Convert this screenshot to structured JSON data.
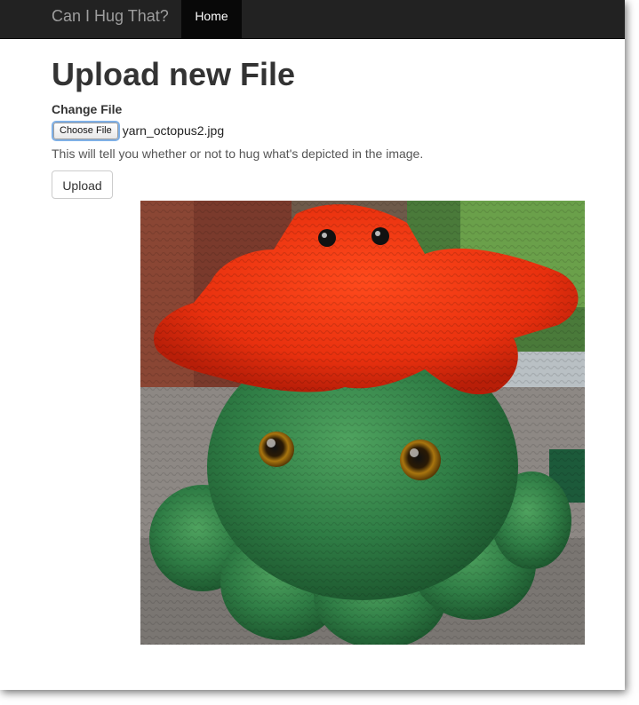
{
  "navbar": {
    "brand": "Can I Hug That?",
    "home_label": "Home"
  },
  "page": {
    "title": "Upload new File",
    "field_label": "Change File",
    "choose_file_label": "Choose File",
    "file_name": "yarn_octopus2.jpg",
    "help_text": "This will tell you whether or not to hug what's depicted in the image.",
    "upload_label": "Upload"
  },
  "colors": {
    "navbar_bg": "#222222",
    "active_nav_bg": "#080808",
    "brand_text": "#9d9d9d"
  }
}
